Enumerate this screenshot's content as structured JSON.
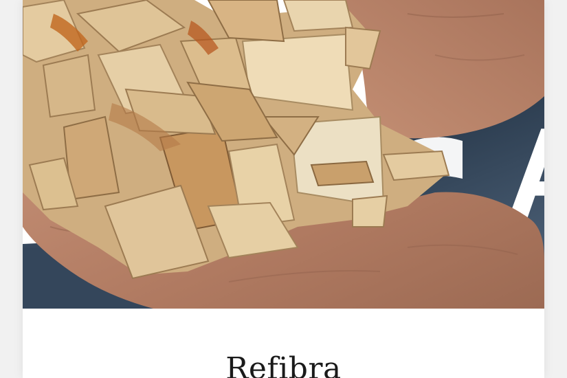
{
  "card": {
    "title": "Refibra",
    "background_text": "A"
  },
  "colors": {
    "page_background": "#f1f1f1",
    "card_background": "#ffffff",
    "denim": "#3c5168",
    "skin": "#b98468",
    "wood": "#d7b88a",
    "title_text": "#1a1a1a"
  }
}
